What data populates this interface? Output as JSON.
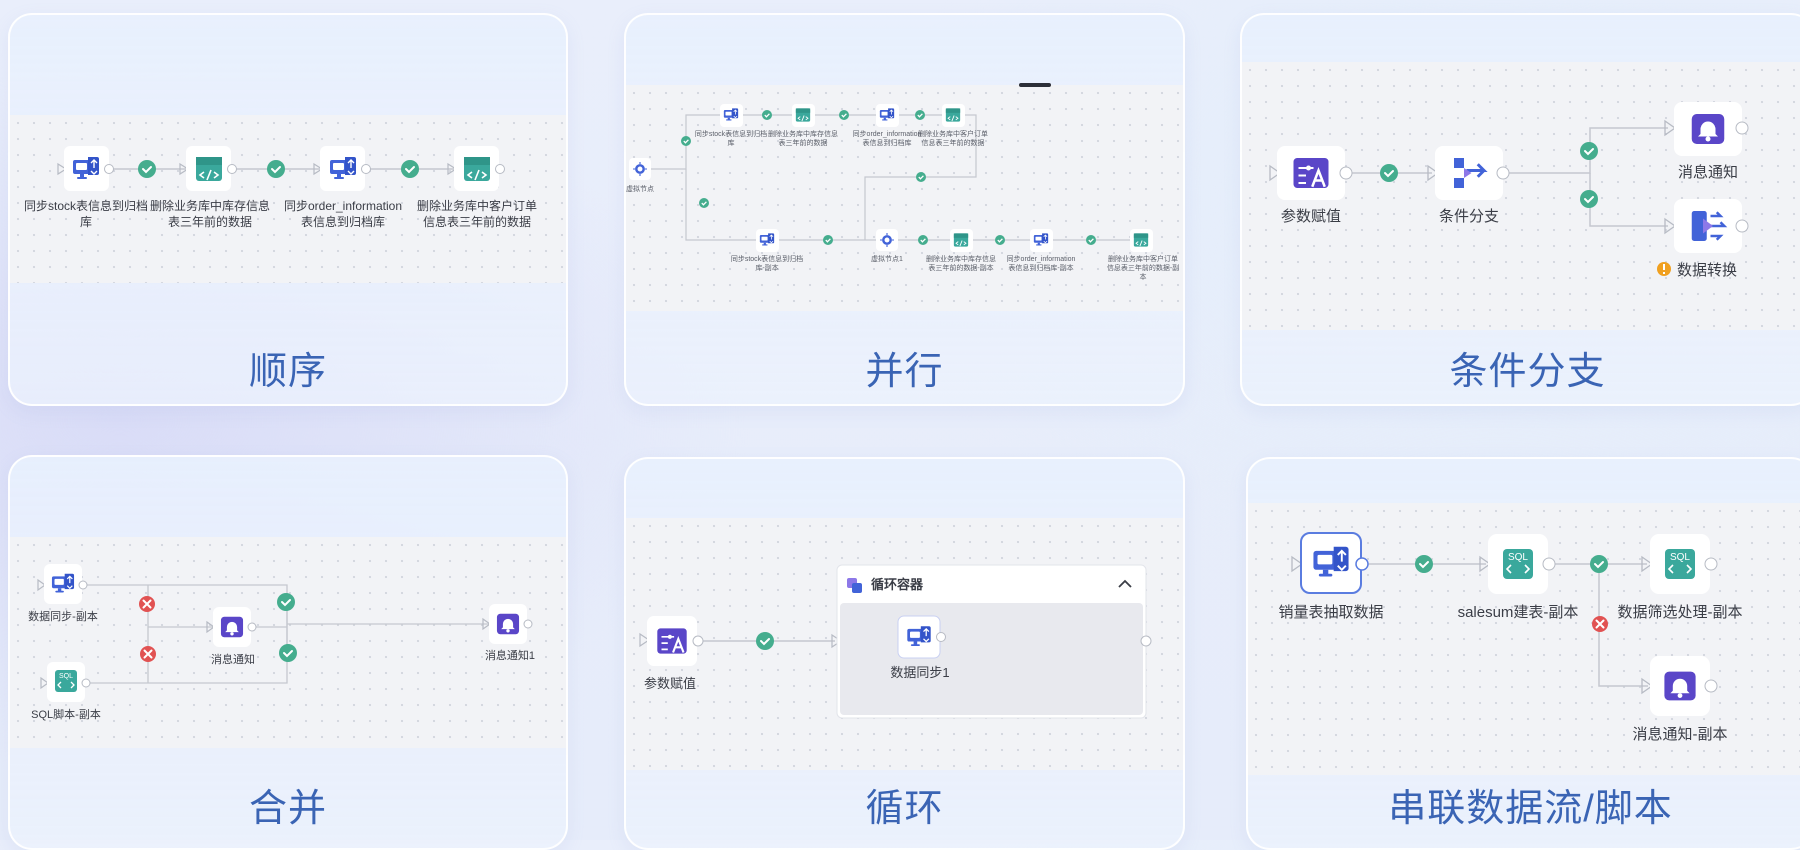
{
  "cards": {
    "sequential": {
      "title": "顺序",
      "nodes": [
        {
          "line1": "同步stock表信息到归档",
          "line2": "库"
        },
        {
          "line1": "删除业务库中库存信息",
          "line2": "表三年前的数据"
        },
        {
          "line1": "同步order_information",
          "line2": "表信息到归档库"
        },
        {
          "line1": "删除业务库中客户订单",
          "line2": "信息表三年前的数据"
        }
      ]
    },
    "parallel": {
      "title": "并行",
      "virtual_node": "虚拟节点",
      "virtual_node_1": "虚拟节点1",
      "top_nodes": [
        {
          "line1": "同步stock表信息到归档",
          "line2": "库"
        },
        {
          "line1": "删除业务库中库存信息",
          "line2": "表三年前的数据"
        },
        {
          "line1": "同步order_information",
          "line2": "表信息到归档库"
        },
        {
          "line1": "删除业务库中客户订单",
          "line2": "信息表三年前的数据"
        }
      ],
      "bottom_first": {
        "line1": "同步stock表信息到归档",
        "line2": "库-副本"
      },
      "bottom_nodes": [
        {
          "line1": "删除业务库中库存信息",
          "line2": "表三年前的数据-副本",
          "line3": ""
        },
        {
          "line1": "同步order_information",
          "line2": "表信息到归档库-副本",
          "line3": ""
        },
        {
          "line1": "删除业务库中客户订单",
          "line2": "信息表三年前的数据-副",
          "line3": "本"
        }
      ]
    },
    "branch": {
      "title": "条件分支",
      "param": "参数赋值",
      "condition": "条件分支",
      "notify": "消息通知",
      "transform": "数据转换"
    },
    "merge": {
      "title": "合并",
      "sync": "数据同步-副本",
      "sql": "SQL脚本-副本",
      "notify": "消息通知",
      "notify1": "消息通知1",
      "sql_text": "SQL"
    },
    "loop": {
      "title": "循环",
      "param": "参数赋值",
      "container": "循环容器",
      "sync": "数据同步1"
    },
    "chain": {
      "title": "串联数据流/脚本",
      "extract": "销量表抽取数据",
      "build": "salesum建表-副本",
      "filter": "数据筛选处理-副本",
      "notify": "消息通知-副本",
      "sql_text": "SQL"
    }
  },
  "icons": {
    "sync": "sync-db-icon",
    "sql": "sql-script-icon",
    "bell": "bell-icon",
    "param": "param-assign-icon",
    "branch": "condition-branch-icon",
    "transform": "data-transform-icon",
    "virtual": "virtual-node-icon",
    "ok": "check-circle-icon",
    "fail": "x-circle-icon",
    "warn": "warning-icon",
    "chevron": "chevron-up-icon"
  },
  "colors": {
    "title": "#3a64b4",
    "ok": "#45ad8e",
    "fail": "#e15252",
    "sync_icon": "#4263d8",
    "sql_icon": "#3aa89c",
    "purple_icon": "#5a46c8",
    "warn": "#f0a020"
  }
}
